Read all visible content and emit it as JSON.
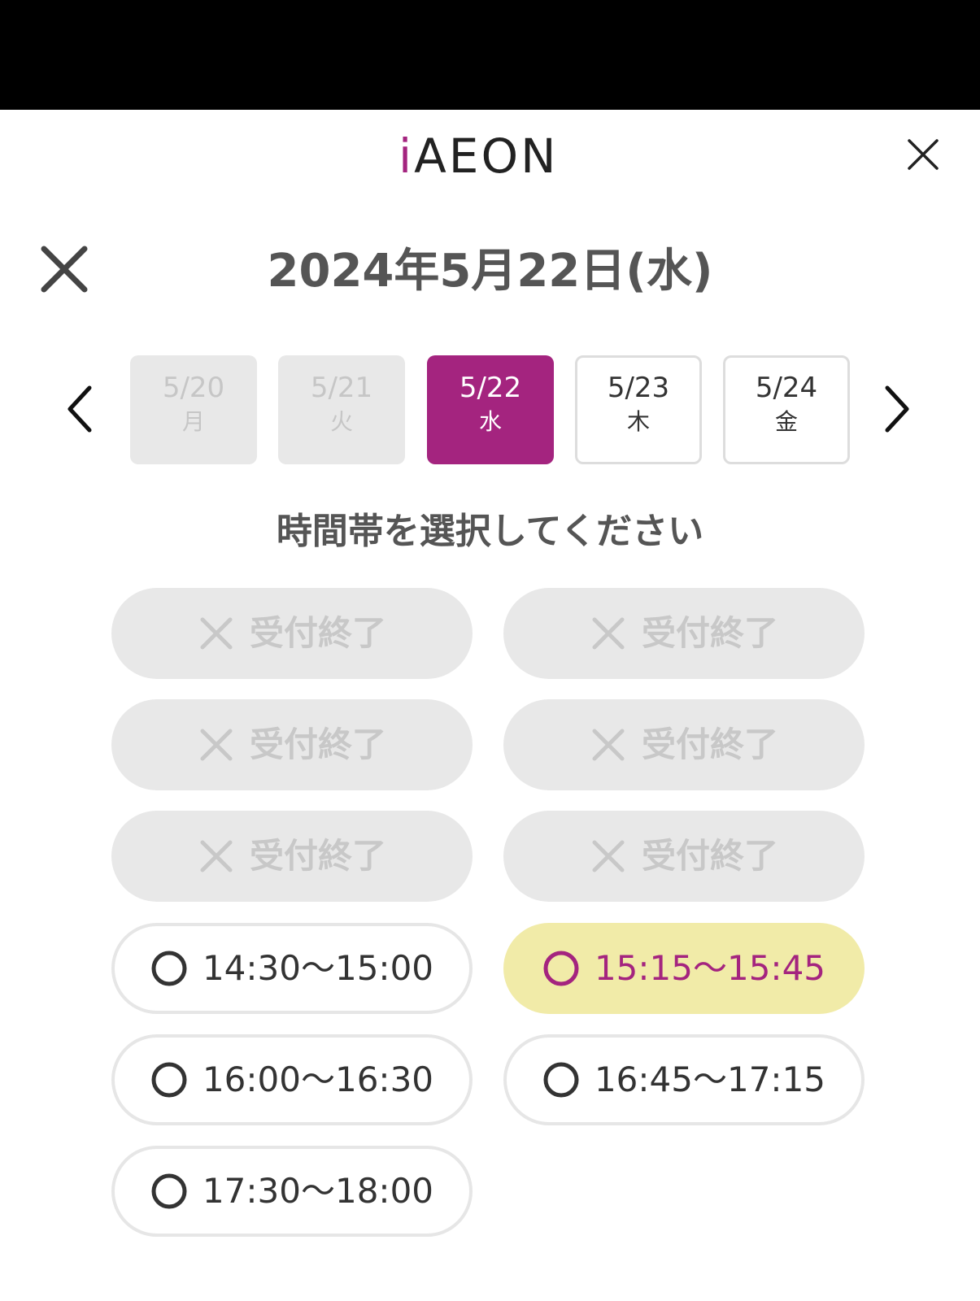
{
  "header": {
    "logo_prefix": "i",
    "logo_text": "AEON"
  },
  "date_title": "2024年5月22日(水)",
  "days": [
    {
      "date": "5/20",
      "weekday": "月",
      "state": "disabled"
    },
    {
      "date": "5/21",
      "weekday": "火",
      "state": "disabled"
    },
    {
      "date": "5/22",
      "weekday": "水",
      "state": "selected"
    },
    {
      "date": "5/23",
      "weekday": "木",
      "state": "available"
    },
    {
      "date": "5/24",
      "weekday": "金",
      "state": "available"
    }
  ],
  "prompt": "時間帯を選択してください",
  "slots": [
    {
      "label": "受付終了",
      "state": "closed"
    },
    {
      "label": "受付終了",
      "state": "closed"
    },
    {
      "label": "受付終了",
      "state": "closed"
    },
    {
      "label": "受付終了",
      "state": "closed"
    },
    {
      "label": "受付終了",
      "state": "closed"
    },
    {
      "label": "受付終了",
      "state": "closed"
    },
    {
      "label": "14:30〜15:00",
      "state": "open"
    },
    {
      "label": "15:15〜15:45",
      "state": "selected"
    },
    {
      "label": "16:00〜16:30",
      "state": "open"
    },
    {
      "label": "16:45〜17:15",
      "state": "open"
    },
    {
      "label": "17:30〜18:00",
      "state": "open"
    }
  ],
  "colors": {
    "accent": "#a4247f",
    "selected_slot_bg": "#f1eba8",
    "disabled_bg": "#e8e8e8",
    "disabled_text": "#c8c8c8"
  }
}
